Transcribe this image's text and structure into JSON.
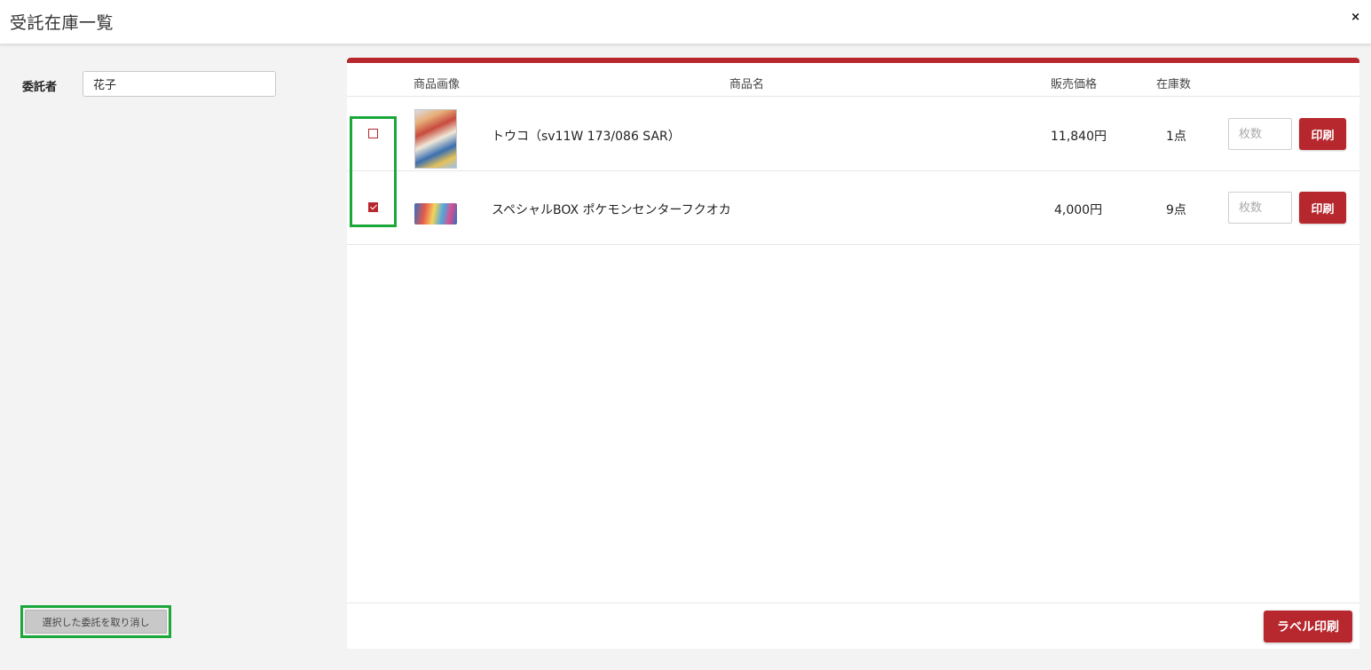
{
  "window": {
    "title": "受託在庫一覧",
    "close_label": "×"
  },
  "sidebar": {
    "consignor_label": "委託者",
    "consignor_value": "花子",
    "cancel_button_label": "選択した委託を取り消し"
  },
  "table": {
    "headers": {
      "image": "商品画像",
      "name": "商品名",
      "price": "販売価格",
      "stock": "在庫数"
    },
    "rows": [
      {
        "checked": false,
        "name": "トウコ（sv11W 173/086 SAR）",
        "price": "11,840円",
        "stock": "1点",
        "qty_placeholder": "枚数",
        "print_label": "印刷"
      },
      {
        "checked": true,
        "name": "スペシャルBOX ポケモンセンターフクオカ",
        "price": "4,000円",
        "stock": "9点",
        "qty_placeholder": "枚数",
        "print_label": "印刷"
      }
    ]
  },
  "footer": {
    "label_print_label": "ラベル印刷"
  },
  "colors": {
    "accent": "#b7282e",
    "highlight": "#1aa83a"
  }
}
